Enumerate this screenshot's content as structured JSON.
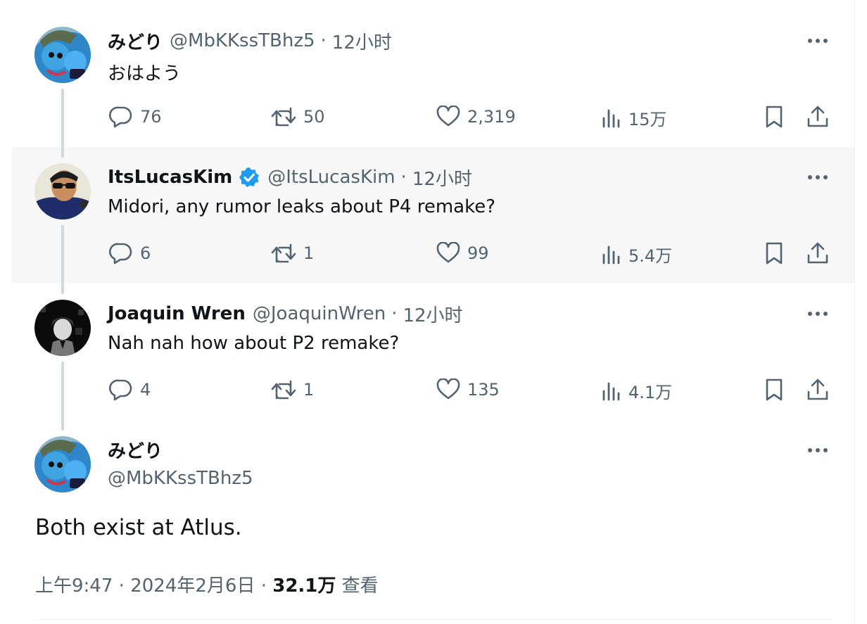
{
  "tweets": [
    {
      "name": "みどり",
      "handle": "@MbKKssTBhz5",
      "time": "12小时",
      "text": "おはよう",
      "replies": "76",
      "retweets": "50",
      "likes": "2,319",
      "views": "15万"
    },
    {
      "name": "ItsLucasKim",
      "handle": "@ItsLucasKim",
      "time": "12小时",
      "text": "Midori, any rumor leaks about P4 remake?",
      "replies": "6",
      "retweets": "1",
      "likes": "99",
      "views": "5.4万"
    },
    {
      "name": "Joaquin Wren",
      "handle": "@JoaquinWren",
      "time": "12小时",
      "text": "Nah nah how about P2 remake?",
      "replies": "4",
      "retweets": "1",
      "likes": "135",
      "views": "4.1万"
    }
  ],
  "main_tweet": {
    "name": "みどり",
    "handle": "@MbKKssTBhz5",
    "text": "Both exist at Atlus.",
    "time": "上午9:47",
    "date": "2024年2月6日",
    "views_count": "32.1万",
    "views_label": "查看"
  },
  "separator": "·",
  "colors": {
    "text": "#0f1419",
    "secondary": "#536471",
    "verified": "#1d9bf0",
    "thread_line": "#cfd9de",
    "highlight_bg": "#f7f7f7"
  },
  "icons": [
    "reply-icon",
    "retweet-icon",
    "like-icon",
    "views-icon",
    "bookmark-icon",
    "share-icon",
    "more-icon",
    "verified-badge-icon"
  ]
}
